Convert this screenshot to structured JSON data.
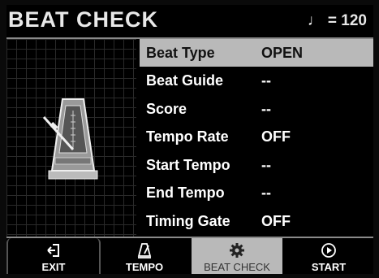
{
  "header": {
    "title": "BEAT CHECK",
    "tempo_symbol": "♩",
    "tempo_value": "= 120"
  },
  "settings": [
    {
      "label": "Beat Type",
      "value": "OPEN",
      "selected": true
    },
    {
      "label": "Beat Guide",
      "value": "--"
    },
    {
      "label": "Score",
      "value": "--"
    },
    {
      "label": "Tempo Rate",
      "value": "OFF"
    },
    {
      "label": "Start Tempo",
      "value": "--"
    },
    {
      "label": "End Tempo",
      "value": "--"
    },
    {
      "label": "Timing Gate",
      "value": "OFF"
    }
  ],
  "bottom_bar": {
    "exit_label": "EXIT",
    "tempo_label": "TEMPO",
    "beat_check_label": "BEAT CHECK",
    "start_label": "START"
  },
  "colors": {
    "selected_row": "#b9b9b9",
    "background": "#000000",
    "text": "#ffffff"
  }
}
